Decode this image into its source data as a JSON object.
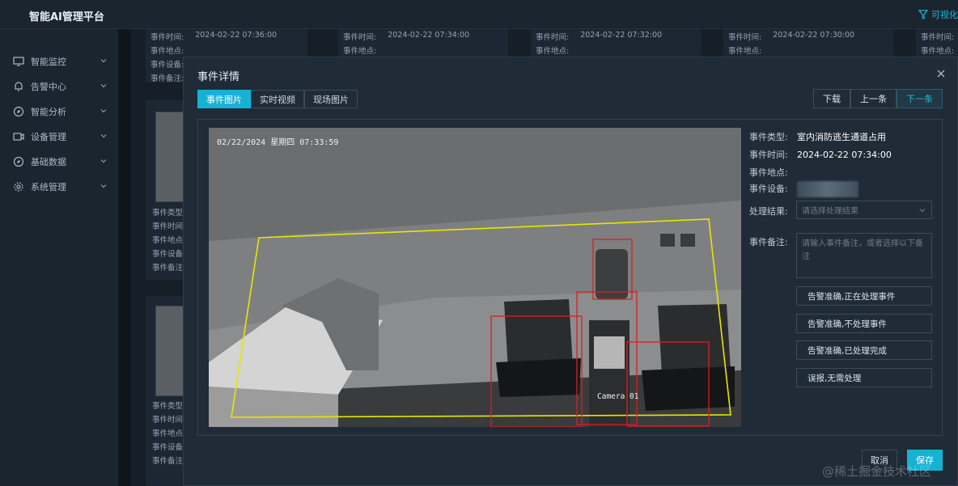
{
  "app": {
    "title": "智能AI管理平台",
    "top_link": "可视化"
  },
  "sidebar": {
    "items": [
      {
        "label": "智能监控",
        "icon": "monitor-icon"
      },
      {
        "label": "告警中心",
        "icon": "bell-icon"
      },
      {
        "label": "智能分析",
        "icon": "compass-icon"
      },
      {
        "label": "设备管理",
        "icon": "camera-icon"
      },
      {
        "label": "基础数据",
        "icon": "compass-icon"
      },
      {
        "label": "系统管理",
        "icon": "gear-icon"
      }
    ]
  },
  "background": {
    "labels": {
      "time": "事件时间:",
      "place": "事件地点:",
      "device": "事件设备:",
      "note": "事件备注:",
      "type": "事件类型:"
    },
    "times": [
      "2024-02-22 07:36:00",
      "2024-02-22 07:34:00",
      "2024-02-22 07:32:00",
      "2024-02-22 07:30:00"
    ]
  },
  "modal": {
    "title": "事件详情",
    "tabs": [
      "事件图片",
      "实时视频",
      "现场图片"
    ],
    "nav": {
      "download": "下载",
      "prev": "上一条",
      "next": "下一条"
    },
    "camera": {
      "timestamp": "02/22/2024 星期四 07:33:59",
      "name": "Camera 01"
    },
    "info": {
      "type_label": "事件类型:",
      "type_value": "室内消防逃生通道占用",
      "time_label": "事件时间:",
      "time_value": "2024-02-22 07:34:00",
      "place_label": "事件地点:",
      "device_label": "事件设备:",
      "result_label": "处理结果:",
      "result_placeholder": "请选择处理结果",
      "note_label": "事件备注:",
      "note_placeholder": "请输入事件备注，或者选择以下备注"
    },
    "actions": [
      "告警准确,正在处理事件",
      "告警准确,不处理事件",
      "告警准确,已处理完成",
      "误报,无需处理"
    ],
    "footer": {
      "cancel": "取消",
      "save": "保存"
    }
  },
  "watermark": "@稀土掘金技术社区",
  "colors": {
    "accent": "#17b2d3",
    "zone": "#e6e600",
    "detection": "#d92020"
  }
}
